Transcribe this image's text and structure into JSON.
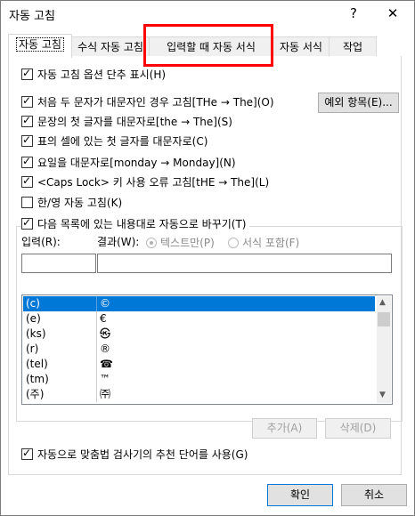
{
  "window": {
    "title": "자동 고침",
    "help": "?",
    "close": "✕"
  },
  "tabs": [
    {
      "label": "자동 고침"
    },
    {
      "label": "수식 자동 고침"
    },
    {
      "label": "입력할 때 자동 서식"
    },
    {
      "label": "자동 서식"
    },
    {
      "label": "작업"
    }
  ],
  "options": {
    "show_buttons": "자동 고침 옵션 단추 표시(H)",
    "two_initial_caps": "처음 두 문자가 대문자인 경우 고침[THe → The](O)",
    "first_letter_sentence": "문장의 첫 글자를 대문자로[the → The](S)",
    "first_letter_table": "표의 셀에 있는 첫 글자를 대문자로(C)",
    "day_names": "요일을 대문자로[monday → Monday](N)",
    "caps_lock": "<Caps Lock> 키 사용 오류 고침[tHE → The](L)",
    "hangul": "한/영 자동 고침(K)",
    "exceptions_button": "예외 항목(E)..."
  },
  "replace": {
    "toggle_label": "다음 목록에 있는 내용대로 자동으로 바꾸기(T)",
    "input_label": "입력(R):",
    "result_label": "결과(W):",
    "radio_plain": "텍스트만(P)",
    "radio_formatted": "서식 포함(F)",
    "input_value": "",
    "result_value": "",
    "entries": [
      {
        "from": "(c)",
        "to": "©"
      },
      {
        "from": "(e)",
        "to": "€"
      },
      {
        "from": "(ks)",
        "to": "㉿"
      },
      {
        "from": "(r)",
        "to": "®"
      },
      {
        "from": "(tel)",
        "to": "☎"
      },
      {
        "from": "(tm)",
        "to": "™"
      },
      {
        "from": "(주)",
        "to": "㈜"
      }
    ],
    "add_button": "추가(A)",
    "delete_button": "삭제(D)",
    "use_speller": "자동으로 맞춤법 검사기의 추천 단어를 사용(G)"
  },
  "footer": {
    "ok": "확인",
    "cancel": "취소"
  }
}
